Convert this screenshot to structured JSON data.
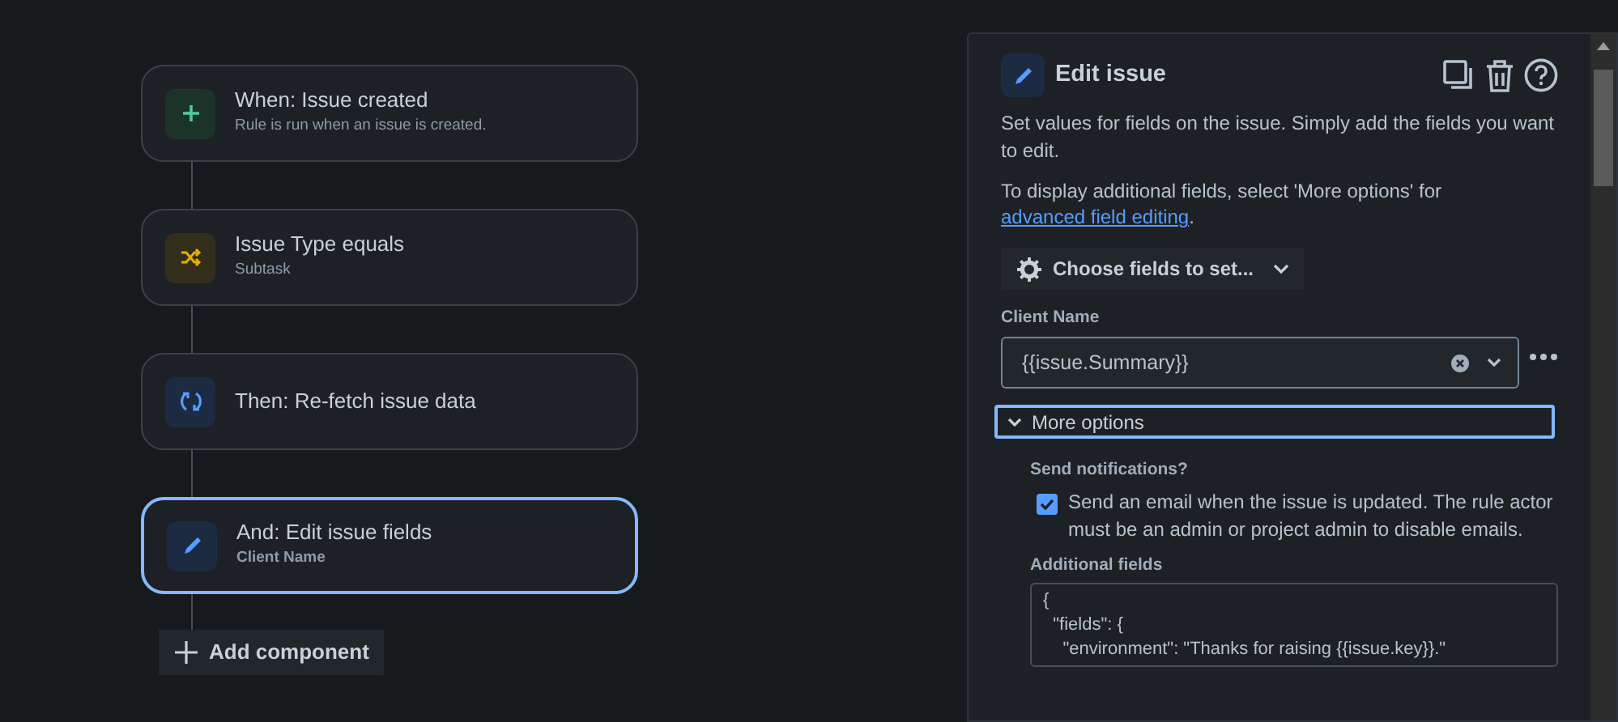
{
  "nodes": [
    {
      "kind": "trigger",
      "title": "When: Issue created",
      "subtitle": "Rule is run when an issue is created.",
      "selected": false
    },
    {
      "kind": "condition",
      "title": "Issue Type equals",
      "subtitle": "Subtask",
      "selected": false
    },
    {
      "kind": "refetch",
      "title": "Then: Re-fetch issue data",
      "selected": false
    },
    {
      "kind": "edit",
      "title": "And: Edit issue fields",
      "subtitle": "Client Name",
      "selected": true
    }
  ],
  "add_button": "Add component",
  "panel": {
    "title": "Edit issue",
    "description": "Set values for fields on the issue. Simply add the fields you want to edit.",
    "hint": "To display additional fields, select 'More options' for ",
    "hint_link": "advanced field editing",
    "hint_end": ".",
    "choose_button": "Choose fields to set...",
    "field": {
      "label": "Client Name",
      "value": "{{issue.Summary}}"
    },
    "more_options": {
      "label": "More options",
      "expanded": true
    },
    "notifications": {
      "label": "Send notifications?",
      "checked": true,
      "text": "Send an email when the issue is updated. The rule actor must be an admin or project admin to disable emails."
    },
    "additional_fields": {
      "label": "Additional fields",
      "lines": [
        "{",
        "  \"fields\": {",
        "    \"environment\": \"Thanks for raising {{issue.key}}.\""
      ]
    }
  }
}
